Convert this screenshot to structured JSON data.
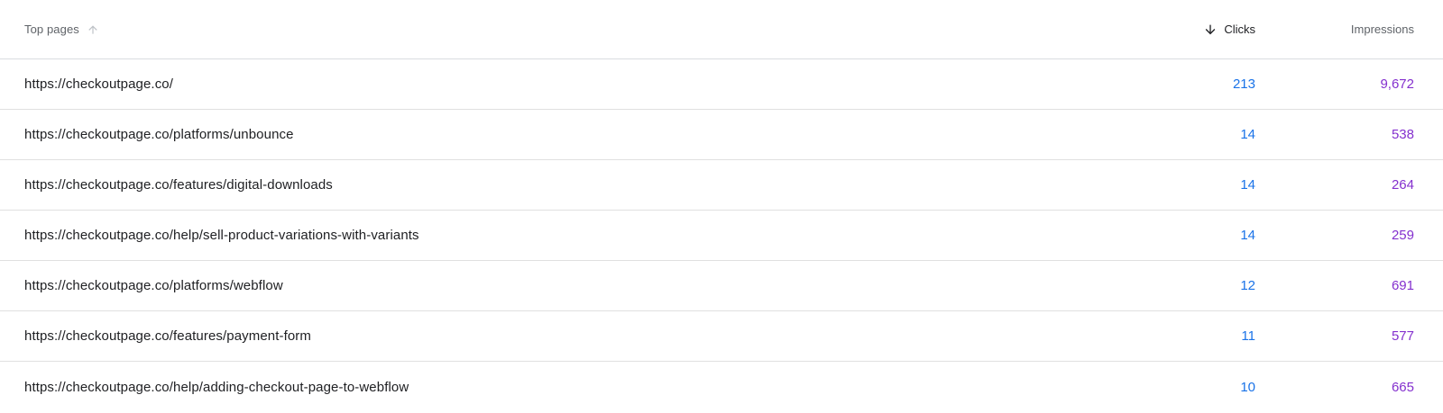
{
  "table": {
    "headers": {
      "page": "Top pages",
      "clicks": "Clicks",
      "impressions": "Impressions"
    },
    "rows": [
      {
        "page": "https://checkoutpage.co/",
        "clicks": "213",
        "impressions": "9,672"
      },
      {
        "page": "https://checkoutpage.co/platforms/unbounce",
        "clicks": "14",
        "impressions": "538"
      },
      {
        "page": "https://checkoutpage.co/features/digital-downloads",
        "clicks": "14",
        "impressions": "264"
      },
      {
        "page": "https://checkoutpage.co/help/sell-product-variations-with-variants",
        "clicks": "14",
        "impressions": "259"
      },
      {
        "page": "https://checkoutpage.co/platforms/webflow",
        "clicks": "12",
        "impressions": "691"
      },
      {
        "page": "https://checkoutpage.co/features/payment-form",
        "clicks": "11",
        "impressions": "577"
      },
      {
        "page": "https://checkoutpage.co/help/adding-checkout-page-to-webflow",
        "clicks": "10",
        "impressions": "665"
      }
    ]
  },
  "icons": {
    "page_sort": "arrow-up-icon",
    "clicks_sort": "arrow-down-icon"
  },
  "colors": {
    "clicks": "#1a73e8",
    "impressions": "#8430ce",
    "divider": "#e0e0e0"
  }
}
